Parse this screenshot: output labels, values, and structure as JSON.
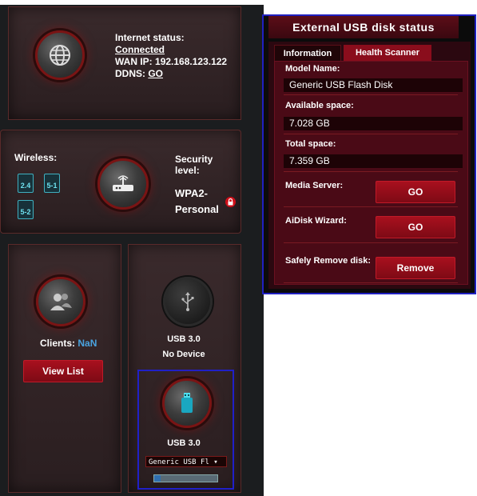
{
  "internet": {
    "status_label": "Internet status:",
    "status_value": "Connected",
    "wan_ip_label": "WAN IP:",
    "wan_ip_value": "192.168.123.122",
    "ddns_label": "DDNS:",
    "ddns_value": "GO"
  },
  "router": {
    "wireless_label": "Wireless:",
    "wifi_bands": [
      "2.4",
      "5-1",
      "5-2"
    ],
    "security_label_line1": "Security",
    "security_label_line2": "level:",
    "security_value_line1": "WPA2-",
    "security_value_line2": "Personal"
  },
  "clients": {
    "label": "Clients:",
    "count": "NaN",
    "view_list": "View List"
  },
  "usb": {
    "port1_label": "USB 3.0",
    "port1_status": "No Device",
    "port2_label": "USB 3.0",
    "port2_select": "Generic USB Fl",
    "port2_progress": 0.1
  },
  "status_panel": {
    "title": "External USB disk status",
    "tabs": [
      "Information",
      "Health Scanner"
    ],
    "model_label": "Model Name:",
    "model_value": "Generic USB Flash Disk",
    "available_label": "Available space:",
    "available_value": "7.028 GB",
    "total_label": "Total space:",
    "total_value": "7.359 GB",
    "media_server_label": "Media Server:",
    "media_server_btn": "GO",
    "aidisk_label": "AiDisk Wizard:",
    "aidisk_btn": "GO",
    "remove_label": "Safely Remove disk:",
    "remove_btn": "Remove"
  },
  "colors": {
    "accent_red": "#a8101e",
    "link_blue": "#4aa3df",
    "highlight_blue": "#2020c8"
  }
}
